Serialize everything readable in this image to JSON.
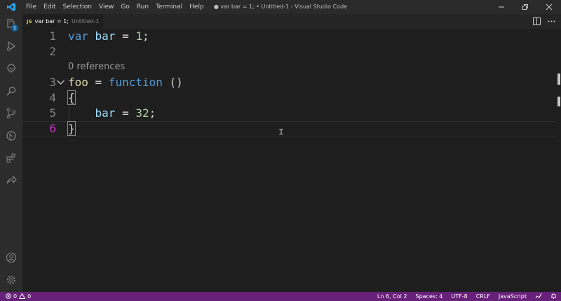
{
  "window": {
    "title": "● var bar = 1; • Untitled-1 - Visual Studio Code",
    "menu": [
      "File",
      "Edit",
      "Selection",
      "View",
      "Go",
      "Run",
      "Terminal",
      "Help"
    ]
  },
  "activity": {
    "explorer_badge": "1",
    "icons": [
      "explorer-icon",
      "run-debug-icon",
      "remote-explorer-icon",
      "search-icon",
      "source-control-icon",
      "git-graph-icon",
      "extensions-icon",
      "live-share-icon",
      "account-icon",
      "settings-gear-icon"
    ]
  },
  "tab": {
    "lang_badge": "JS",
    "name": "var bar = 1;",
    "description": "Untitled-1"
  },
  "editor": {
    "line_numbers": [
      "1",
      "2",
      "3",
      "4",
      "5",
      "6"
    ],
    "codelens": "0 references",
    "active_line": "6"
  },
  "statusbar": {
    "errors": "0",
    "warnings": "0",
    "position": "Ln 6, Col 2",
    "spaces": "Spaces: 4",
    "encoding": "UTF-8",
    "eol": "CRLF",
    "language": "JavaScript"
  },
  "colors": {
    "statusbar": "#68217a",
    "keyword": "#569cd6",
    "variable": "#9cdcfe",
    "number": "#b5cea8",
    "function": "#dcdcaa",
    "active_line_number": "#c838c6"
  }
}
